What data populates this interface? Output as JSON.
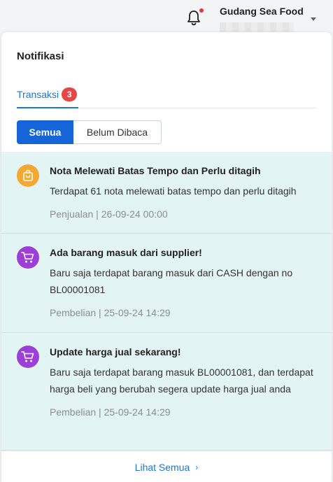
{
  "header": {
    "store_name": "Gudang Sea Food"
  },
  "panel": {
    "title": "Notifikasi",
    "tab": {
      "label": "Transaksi",
      "badge": "3"
    },
    "filters": {
      "all": "Semua",
      "unread": "Belum Dibaca"
    },
    "items": [
      {
        "icon": "shopping-bag-icon",
        "icon_color": "#f4a731",
        "title": "Nota Melewati Batas Tempo dan Perlu ditagih",
        "text": "Terdapat 61 nota melewati batas tempo dan perlu ditagih",
        "category": "Penjualan",
        "datetime": "26-09-24 00:00"
      },
      {
        "icon": "cart-icon",
        "icon_color": "#9c3fd9",
        "title": "Ada barang masuk dari supplier!",
        "text": "Baru saja terdapat barang masuk dari CASH dengan no BL00001081",
        "category": "Pembelian",
        "datetime": "25-09-24 14:29"
      },
      {
        "icon": "cart-icon",
        "icon_color": "#9c3fd9",
        "title": "Update harga jual sekarang!",
        "text": "Baru saja terdapat barang masuk BL00001081, dan terdapat harga beli yang berubah segera update harga jual anda",
        "category": "Pembelian",
        "datetime": "25-09-24 14:29"
      }
    ],
    "footer": {
      "see_all": "Lihat Semua",
      "chevron": "›"
    }
  },
  "meta": {
    "separator": " | "
  }
}
